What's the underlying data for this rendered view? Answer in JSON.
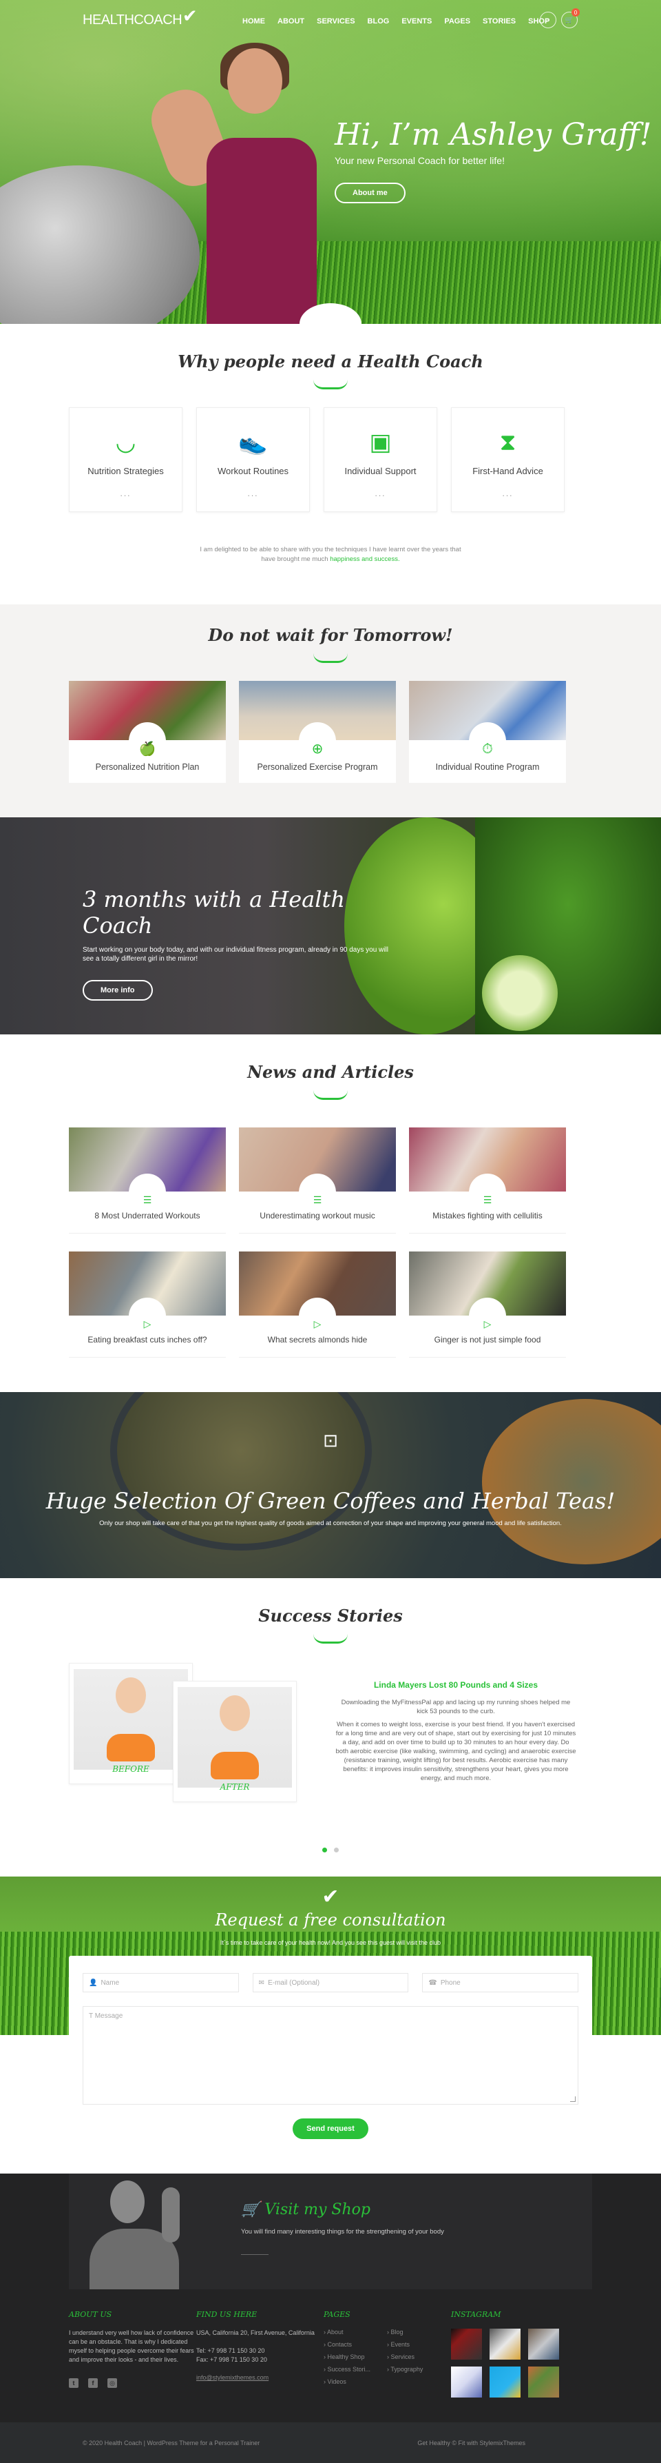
{
  "header": {
    "logo": "HEALTHCOACH",
    "nav": [
      "HOME",
      "ABOUT",
      "SERVICES",
      "BLOG",
      "EVENTS",
      "PAGES",
      "STORIES",
      "SHOP"
    ],
    "cart_count": "0"
  },
  "hero": {
    "title": "Hi, I’m Ashley Graff!",
    "subtitle": "Your new Personal Coach for better life!",
    "button": "About me"
  },
  "why": {
    "title": "Why people need a Health Coach",
    "features": [
      {
        "icon": "watermelon-icon",
        "label": "Nutrition Strategies",
        "more": "..."
      },
      {
        "icon": "sneaker-icon",
        "label": "Workout Routines",
        "more": "..."
      },
      {
        "icon": "heart-monitor-icon",
        "label": "Individual Support",
        "more": "..."
      },
      {
        "icon": "hourglass-icon",
        "label": "First-Hand Advice",
        "more": "..."
      }
    ],
    "intro_text": "I am delighted to be able to share with you the techniques I have learnt over the years that have brought me much",
    "intro_highlight": "happiness and success."
  },
  "wait": {
    "title": "Do not wait for Tomorrow!",
    "cards": [
      {
        "icon": "apple-icon",
        "label": "Personalized Nutrition Plan"
      },
      {
        "icon": "dumbbell-icon",
        "label": "Personalized Exercise Program"
      },
      {
        "icon": "stopwatch-icon",
        "label": "Individual Routine Program"
      }
    ]
  },
  "months": {
    "title": "3 months with a Health Coach",
    "text": "Start working on your body today, and with our individual fitness program, already in 90 days you will see a totally different girl in the mirror!",
    "button": "More info"
  },
  "news": {
    "title": "News and Articles",
    "articles": [
      {
        "type": "text",
        "label": "8 Most Underrated Workouts"
      },
      {
        "type": "text",
        "label": "Underestimating workout music"
      },
      {
        "type": "text",
        "label": "Mistakes fighting with cellulitis"
      },
      {
        "type": "video",
        "label": "Eating breakfast cuts inches off?"
      },
      {
        "type": "video",
        "label": "What secrets almonds hide"
      },
      {
        "type": "video",
        "label": "Ginger is not just simple food"
      }
    ]
  },
  "tea": {
    "title": "Huge Selection Of Green Coffees and Herbal Teas!",
    "text": "Only our shop will take care of that you get the highest quality of goods aimed at correction of your shape and improving your general mood and life satisfaction."
  },
  "stories": {
    "title": "Success Stories",
    "before_label": "BEFORE",
    "after_label": "AFTER",
    "story_title": "Linda Mayers Lost 80 Pounds and 4 Sizes",
    "p1": "Downloading the MyFitnessPal app and lacing up my running shoes helped me kick 53 pounds to the curb.",
    "p2": "When it comes to weight loss, exercise is your best friend. If you haven't exercised for a long time and are very out of shape, start out by exercising for just 10 minutes a day, and add on over time to build up to 30 minutes to an hour every day. Do both aerobic exercise (like walking, swimming, and cycling) and anaerobic exercise (resistance training, weight lifting) for best results. Aerobic exercise has many benefits: it improves insulin sensitivity, strengthens your heart, gives you more energy, and much more.",
    "slides": 2,
    "active_slide": 1
  },
  "consult": {
    "title": "Request a free consultation",
    "subtitle": "It`s time to take care of your health now! And you see this guest will visit the club",
    "name_placeholder": "Name",
    "email_placeholder": "E-mail (Optional)",
    "phone_placeholder": "Phone",
    "message_placeholder": "Message",
    "button": "Send request"
  },
  "shop": {
    "title": "Visit my Shop",
    "text": "You will find many interesting things for the strengthening of your body"
  },
  "footer": {
    "about_title": "ABOUT US",
    "about_text": "I understand very well how lack of confidence can be an obstacle. That is why I dedicated myself to helping people overcome their fears and improve their looks - and their lives.",
    "find_title": "FIND US HERE",
    "address": "USA, California 20, First Avenue, California",
    "tel": "Tel: +7 998 71 150 30 20",
    "fax": "Fax: +7 998 71 150 30 20",
    "email": "info@stylemixthemes.com",
    "pages_title": "PAGES",
    "pages": [
      "About",
      "Blog",
      "Contacts",
      "Events",
      "Healthy Shop",
      "Services",
      "Success Stori...",
      "Typography",
      "Videos"
    ],
    "instagram_title": "INSTAGRAM",
    "copyright": "© 2020 Health Coach | WordPress Theme for a Personal Trainer",
    "credit": "Get Healthy © Fit with StylemixThemes"
  },
  "colors": {
    "accent": "#2ac139",
    "dark": "#232324",
    "badge": "#f05a3c"
  }
}
